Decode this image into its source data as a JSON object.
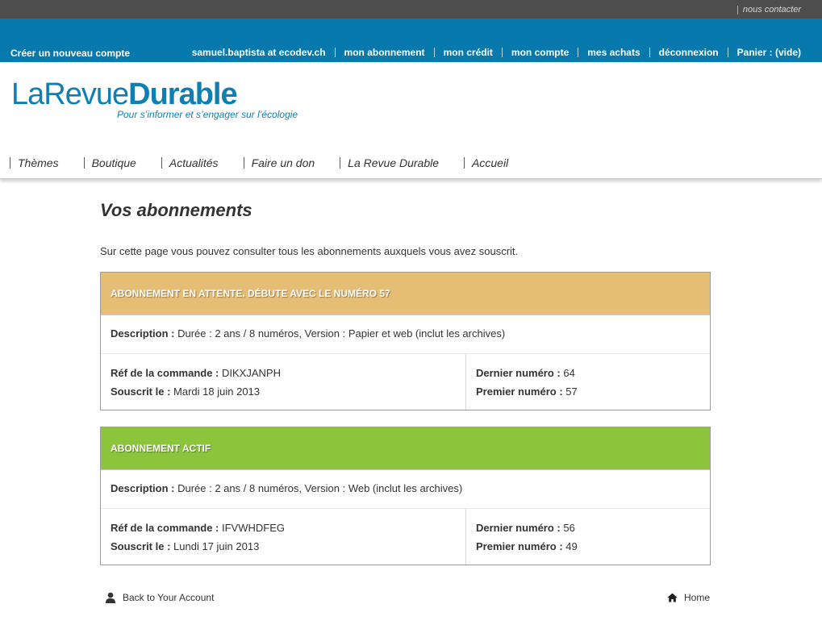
{
  "topbar": {
    "contact": "nous contacter"
  },
  "userbar": {
    "create_account": "Créer un nouveau compte",
    "links": [
      "samuel.baptista at ecodev.ch",
      "mon abonnement",
      "mon crédit",
      "mon compte",
      "mes achats",
      "déconnexion",
      "Panier : (vide)"
    ]
  },
  "logo": {
    "part1": "LaRevue",
    "part2": "Durable",
    "tagline": "Pour s’informer et s’engager sur l’écologie"
  },
  "nav": [
    "Thèmes",
    "Boutique",
    "Actualités",
    "Faire un don",
    "La Revue Durable",
    "Accueil"
  ],
  "page": {
    "title": "Vos abonnements",
    "intro": "Sur cette page vous pouvez consulter tous les abonnements auxquels vous avez souscrit."
  },
  "labels": {
    "description": "Description :",
    "ref": "Réf de la commande :",
    "souscrit": "Souscrit le :",
    "dernier": "Dernier numéro :",
    "premier": "Premier numéro :"
  },
  "subscriptions": [
    {
      "status": "Abonnement en attente. Débute avec le numéro 57",
      "status_color": "#e6bd74",
      "description": "Durée : 2 ans / 8 numéros, Version : Papier et web (inclut les archives)",
      "ref": "DIKXJANPH",
      "souscrit": "Mardi 18 juin 2013",
      "dernier": "64",
      "premier": "57"
    },
    {
      "status": "Abonnement actif",
      "status_color": "#8cc43c",
      "description": "Durée : 2 ans / 8 numéros, Version : Web (inclut les archives)",
      "ref": "IFVWHDFEG",
      "souscrit": "Lundi 17 juin 2013",
      "dernier": "56",
      "premier": "49"
    }
  ],
  "footer": {
    "back": "Back to Your Account",
    "home": "Home",
    "back_icon": "user-icon",
    "home_icon": "home-icon"
  },
  "colors": {
    "topbar": "#4d4d4d",
    "userbar": "#0779ad",
    "brand": "#0d7fb4"
  }
}
